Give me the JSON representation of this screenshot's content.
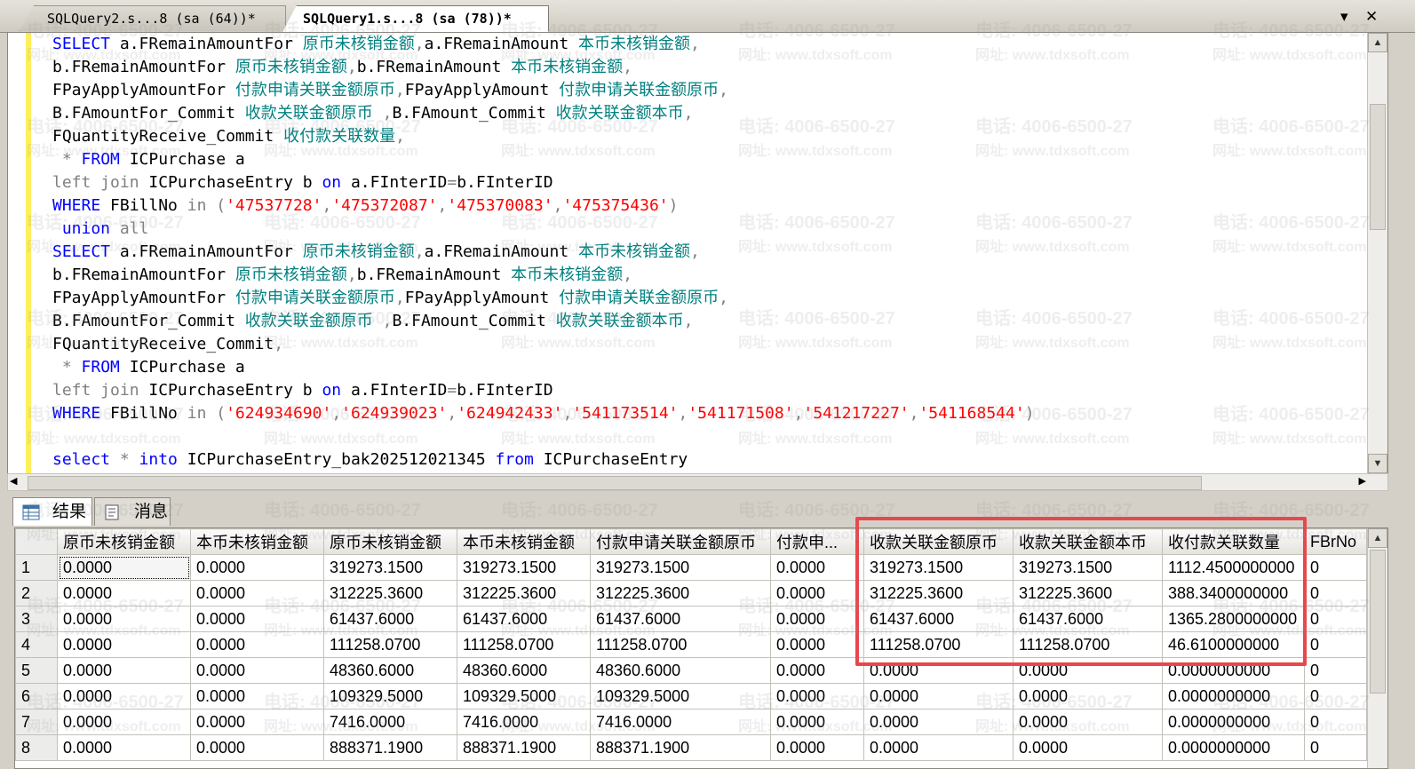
{
  "tabs": [
    {
      "label": "SQLQuery2.s...8 (sa (64))*"
    },
    {
      "label": "SQLQuery1.s...8 (sa (78))*"
    }
  ],
  "window_controls": {
    "dropdown": "▾",
    "close": "✕"
  },
  "sql_lines": [
    [
      [
        "k",
        "SELECT "
      ],
      [
        "c",
        "a.FRemainAmountFor "
      ],
      [
        "t",
        "原币未核销金额"
      ],
      [
        "g",
        ","
      ],
      [
        "c",
        "a.FRemainAmount "
      ],
      [
        "t",
        "本币未核销金额"
      ],
      [
        "g",
        ","
      ]
    ],
    [
      [
        "c",
        "b.FRemainAmountFor "
      ],
      [
        "t",
        "原币未核销金额"
      ],
      [
        "g",
        ","
      ],
      [
        "c",
        "b.FRemainAmount "
      ],
      [
        "t",
        "本币未核销金额"
      ],
      [
        "g",
        ","
      ]
    ],
    [
      [
        "c",
        "FPayApplyAmountFor "
      ],
      [
        "t",
        "付款申请关联金额原币"
      ],
      [
        "g",
        ","
      ],
      [
        "c",
        "FPayApplyAmount "
      ],
      [
        "t",
        "付款申请关联金额原币"
      ],
      [
        "g",
        ","
      ]
    ],
    [
      [
        "c",
        "B.FAmountFor_Commit "
      ],
      [
        "t",
        "收款关联金额原币 "
      ],
      [
        "g",
        ","
      ],
      [
        "c",
        "B.FAmount_Commit "
      ],
      [
        "t",
        "收款关联金额本币"
      ],
      [
        "g",
        ","
      ]
    ],
    [
      [
        "c",
        "FQuantityReceive_Commit "
      ],
      [
        "t",
        "收付款关联数量"
      ],
      [
        "g",
        ","
      ]
    ],
    [
      [
        "g",
        " * "
      ],
      [
        "k",
        "FROM "
      ],
      [
        "c",
        "ICPurchase a"
      ]
    ],
    [
      [
        "g",
        "left join "
      ],
      [
        "c",
        "ICPurchaseEntry b "
      ],
      [
        "k",
        "on "
      ],
      [
        "c",
        "a.FInterID"
      ],
      [
        "g",
        "="
      ],
      [
        "c",
        "b.FInterID"
      ]
    ],
    [
      [
        "k",
        "WHERE "
      ],
      [
        "c",
        "FBillNo "
      ],
      [
        "g",
        "in ("
      ],
      [
        "s",
        "'47537728'"
      ],
      [
        "g",
        ","
      ],
      [
        "s",
        "'475372087'"
      ],
      [
        "g",
        ","
      ],
      [
        "s",
        "'475370083'"
      ],
      [
        "g",
        ","
      ],
      [
        "s",
        "'475375436'"
      ],
      [
        "g",
        ")"
      ]
    ],
    [
      [
        "k",
        " union "
      ],
      [
        "g",
        "all"
      ]
    ],
    [
      [
        "k",
        "SELECT "
      ],
      [
        "c",
        "a.FRemainAmountFor "
      ],
      [
        "t",
        "原币未核销金额"
      ],
      [
        "g",
        ","
      ],
      [
        "c",
        "a.FRemainAmount "
      ],
      [
        "t",
        "本币未核销金额"
      ],
      [
        "g",
        ","
      ]
    ],
    [
      [
        "c",
        "b.FRemainAmountFor "
      ],
      [
        "t",
        "原币未核销金额"
      ],
      [
        "g",
        ","
      ],
      [
        "c",
        "b.FRemainAmount "
      ],
      [
        "t",
        "本币未核销金额"
      ],
      [
        "g",
        ","
      ]
    ],
    [
      [
        "c",
        "FPayApplyAmountFor "
      ],
      [
        "t",
        "付款申请关联金额原币"
      ],
      [
        "g",
        ","
      ],
      [
        "c",
        "FPayApplyAmount "
      ],
      [
        "t",
        "付款申请关联金额原币"
      ],
      [
        "g",
        ","
      ]
    ],
    [
      [
        "c",
        "B.FAmountFor_Commit "
      ],
      [
        "t",
        "收款关联金额原币 "
      ],
      [
        "g",
        ","
      ],
      [
        "c",
        "B.FAmount_Commit "
      ],
      [
        "t",
        "收款关联金额本币"
      ],
      [
        "g",
        ","
      ]
    ],
    [
      [
        "c",
        "FQuantityReceive_Commit"
      ],
      [
        "g",
        ","
      ]
    ],
    [
      [
        "g",
        " * "
      ],
      [
        "k",
        "FROM "
      ],
      [
        "c",
        "ICPurchase a"
      ]
    ],
    [
      [
        "g",
        "left join "
      ],
      [
        "c",
        "ICPurchaseEntry b "
      ],
      [
        "k",
        "on "
      ],
      [
        "c",
        "a.FInterID"
      ],
      [
        "g",
        "="
      ],
      [
        "c",
        "b.FInterID"
      ]
    ],
    [
      [
        "k",
        "WHERE "
      ],
      [
        "c",
        "FBillNo "
      ],
      [
        "g",
        "in ("
      ],
      [
        "s",
        "'624934690'"
      ],
      [
        "g",
        ","
      ],
      [
        "s",
        "'624939023'"
      ],
      [
        "g",
        ","
      ],
      [
        "s",
        "'624942433'"
      ],
      [
        "g",
        ","
      ],
      [
        "s",
        "'541173514'"
      ],
      [
        "g",
        ","
      ],
      [
        "s",
        "'541171508'"
      ],
      [
        "g",
        ","
      ],
      [
        "s",
        "'541217227'"
      ],
      [
        "g",
        ","
      ],
      [
        "s",
        "'541168544'"
      ],
      [
        "g",
        ")"
      ]
    ],
    [
      [
        "c",
        ""
      ]
    ],
    [
      [
        "k",
        "select "
      ],
      [
        "g",
        "* "
      ],
      [
        "k",
        "into "
      ],
      [
        "c",
        "ICPurchaseEntry_bak202512021345 "
      ],
      [
        "k",
        "from "
      ],
      [
        "c",
        "ICPurchaseEntry"
      ]
    ]
  ],
  "result_tabs": {
    "results": "结果",
    "messages": "消息"
  },
  "grid": {
    "columns": [
      "原币未核销金额",
      "本币未核销金额",
      "原币未核销金额",
      "本币未核销金额",
      "付款申请关联金额原币",
      "付款申...",
      "收款关联金额原币",
      "收款关联金额本币",
      "收付款关联数量",
      "FBrNo"
    ],
    "rows": [
      [
        "1",
        "0.0000",
        "0.0000",
        "319273.1500",
        "319273.1500",
        "319273.1500",
        "0.0000",
        "319273.1500",
        "319273.1500",
        "1112.4500000000",
        "0"
      ],
      [
        "2",
        "0.0000",
        "0.0000",
        "312225.3600",
        "312225.3600",
        "312225.3600",
        "0.0000",
        "312225.3600",
        "312225.3600",
        "388.3400000000",
        "0"
      ],
      [
        "3",
        "0.0000",
        "0.0000",
        "61437.6000",
        "61437.6000",
        "61437.6000",
        "0.0000",
        "61437.6000",
        "61437.6000",
        "1365.2800000000",
        "0"
      ],
      [
        "4",
        "0.0000",
        "0.0000",
        "111258.0700",
        "111258.0700",
        "111258.0700",
        "0.0000",
        "111258.0700",
        "111258.0700",
        "46.6100000000",
        "0"
      ],
      [
        "5",
        "0.0000",
        "0.0000",
        "48360.6000",
        "48360.6000",
        "48360.6000",
        "0.0000",
        "0.0000",
        "0.0000",
        "0.0000000000",
        "0"
      ],
      [
        "6",
        "0.0000",
        "0.0000",
        "109329.5000",
        "109329.5000",
        "109329.5000",
        "0.0000",
        "0.0000",
        "0.0000",
        "0.0000000000",
        "0"
      ],
      [
        "7",
        "0.0000",
        "0.0000",
        "7416.0000",
        "7416.0000",
        "7416.0000",
        "0.0000",
        "0.0000",
        "0.0000",
        "0.0000000000",
        "0"
      ],
      [
        "8",
        "0.0000",
        "0.0000",
        "888371.1900",
        "888371.1900",
        "888371.1900",
        "0.0000",
        "0.0000",
        "0.0000",
        "0.0000000000",
        "0"
      ]
    ]
  },
  "watermark": {
    "phone": "电话: 4006-6500-27",
    "site": "网址: www.tdxsoft.com"
  },
  "colors": {
    "keyword": "#0000ff",
    "string": "#ff0000",
    "alias": "#008080",
    "operator": "#808080",
    "highlight": "#e8474d"
  }
}
